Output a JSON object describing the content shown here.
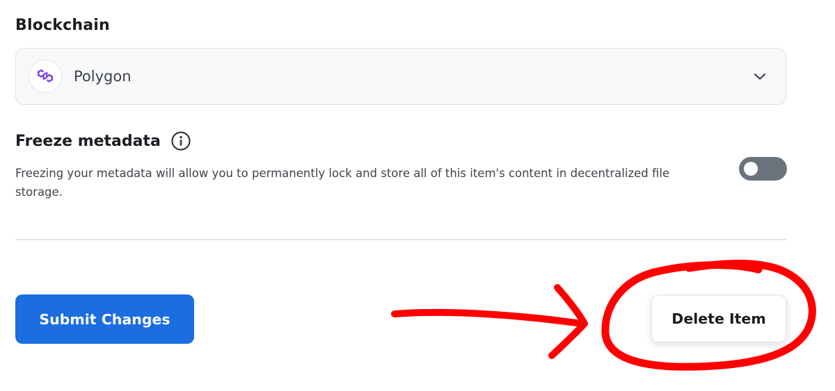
{
  "blockchain": {
    "label": "Blockchain",
    "selected": "Polygon",
    "logo_icon": "polygon-logo-icon",
    "dropdown_icon": "chevron-down-icon"
  },
  "freeze_metadata": {
    "title": "Freeze metadata",
    "info_icon": "info-icon",
    "description": "Freezing your metadata will allow you to permanently lock and store all of this item's content in decentralized file storage.",
    "enabled": false
  },
  "actions": {
    "submit_label": "Submit Changes",
    "delete_label": "Delete Item"
  },
  "colors": {
    "primary": "#1c6ddf",
    "polygon_purple": "#8247e5",
    "toggle_off": "#6b747c",
    "annotation_red": "#ff0000"
  }
}
